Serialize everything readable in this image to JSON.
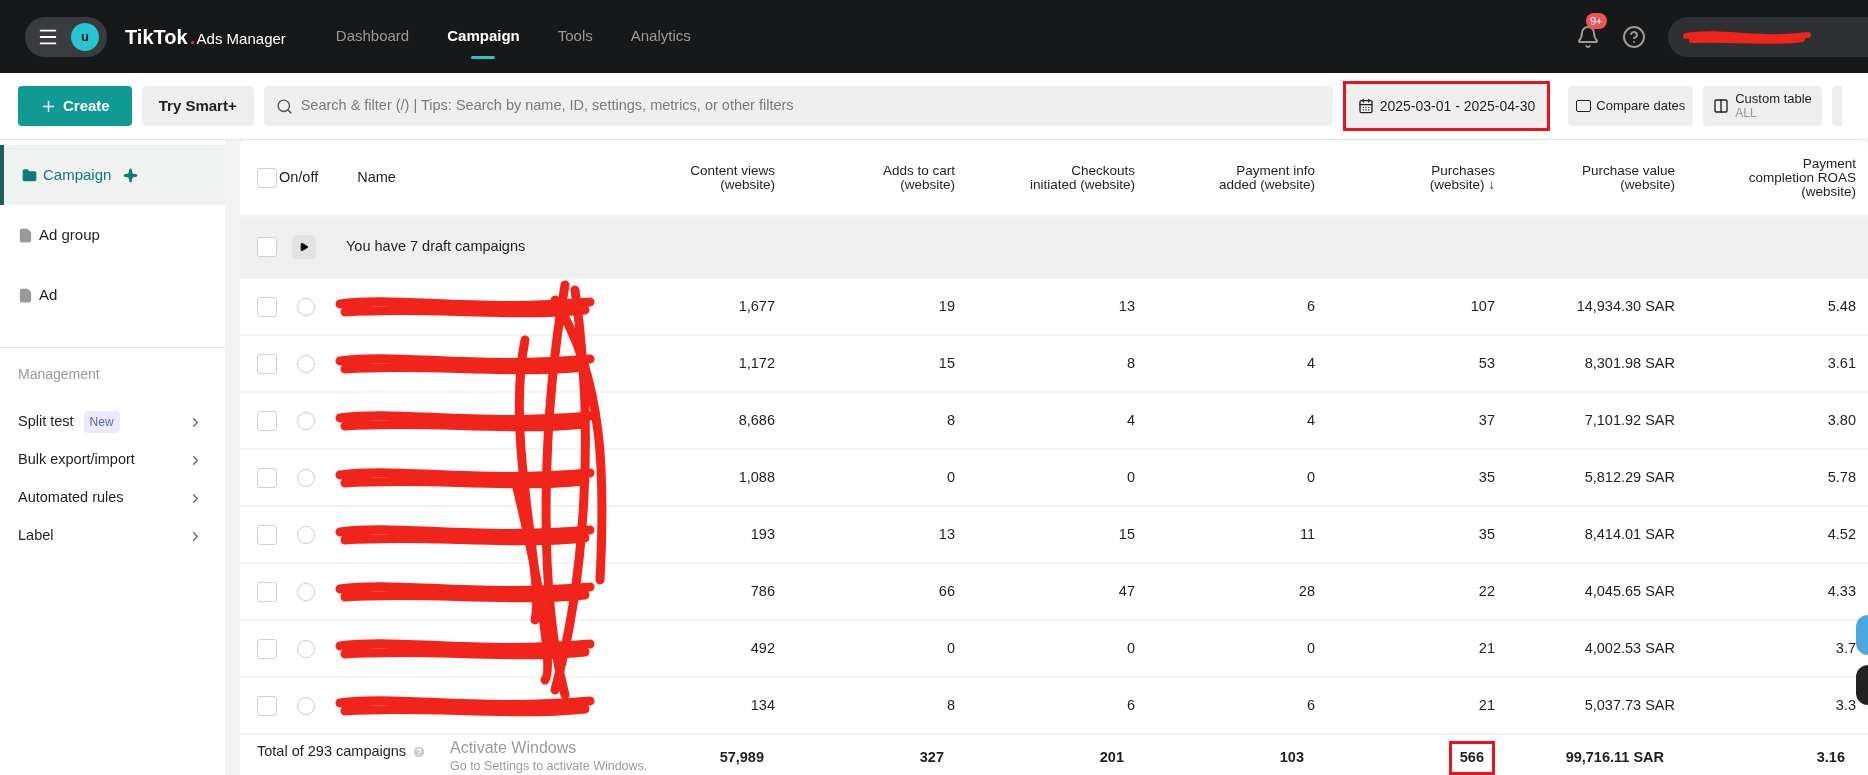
{
  "top_bar": {
    "avatar": "u",
    "logo": "TikTok",
    "logo_suffix": "Ads Manager",
    "nav": [
      {
        "label": "Dashboard",
        "selected": false
      },
      {
        "label": "Campaign",
        "selected": true
      },
      {
        "label": "Tools",
        "selected": false
      },
      {
        "label": "Analytics",
        "selected": false
      }
    ],
    "notification_badge": "9+"
  },
  "toolbar": {
    "create": "Create",
    "smart": "Try Smart+",
    "search": {
      "placeholder": "Search & filter (/) | Tips: Search by name, ID, settings, metrics, or other filters"
    },
    "date_range": {
      "label": "2025-03-01 - 2025-04-30",
      "highlighted": true
    },
    "compare": "Compare dates",
    "custom_table": {
      "label": "Custom table",
      "sub": "ALL"
    }
  },
  "sidebar": {
    "levels": [
      {
        "label": "Campaign",
        "selected": true
      },
      {
        "label": "Ad group",
        "selected": false
      },
      {
        "label": "Ad",
        "selected": false
      }
    ],
    "section": "Management",
    "items": [
      {
        "label": "Split test",
        "badge": "New"
      },
      {
        "label": "Bulk export/import"
      },
      {
        "label": "Automated rules"
      },
      {
        "label": "Label"
      }
    ]
  },
  "table": {
    "select_all": {
      "checked": false
    },
    "onoff": "On/off",
    "name": "Name",
    "columns": [
      "Content views\n(website)",
      "Adds to cart\n(website)",
      "Checkouts\ninitiated (website)",
      "Payment info\nadded (website)",
      "Purchases\n(website) ↓",
      "Purchase value\n(website)",
      "Payment\ncompletion ROAS\n(website)"
    ],
    "draft_row": {
      "text": "You have 7 draft campaigns",
      "checked": false
    },
    "rows": [
      {
        "checked": false,
        "cells": [
          "1,677",
          "19",
          "13",
          "6",
          "107",
          "14,934.30 SAR",
          "5.48"
        ]
      },
      {
        "checked": false,
        "cells": [
          "1,172",
          "15",
          "8",
          "4",
          "53",
          "8,301.98 SAR",
          "3.61"
        ]
      },
      {
        "checked": false,
        "cells": [
          "8,686",
          "8",
          "4",
          "4",
          "37",
          "7,101.92 SAR",
          "3.80"
        ]
      },
      {
        "checked": false,
        "cells": [
          "1,088",
          "0",
          "0",
          "0",
          "35",
          "5,812.29 SAR",
          "5.78"
        ]
      },
      {
        "checked": false,
        "cells": [
          "193",
          "13",
          "15",
          "11",
          "35",
          "8,414.01 SAR",
          "4.52"
        ]
      },
      {
        "checked": false,
        "cells": [
          "786",
          "66",
          "47",
          "28",
          "22",
          "4,045.65 SAR",
          "4.33"
        ]
      },
      {
        "checked": false,
        "cells": [
          "492",
          "0",
          "0",
          "0",
          "21",
          "4,002.53 SAR",
          "3.7"
        ]
      },
      {
        "checked": false,
        "cells": [
          "134",
          "8",
          "6",
          "6",
          "21",
          "5,037.73 SAR",
          "3.3"
        ]
      }
    ],
    "total": {
      "label": "Total of 293 campaigns",
      "values": [
        {
          "text": "57,989",
          "highlighted": false
        },
        {
          "text": "327",
          "highlighted": false
        },
        {
          "text": "201",
          "highlighted": false
        },
        {
          "text": "103",
          "highlighted": false
        },
        {
          "text": "566",
          "highlighted": true
        },
        {
          "text": "99,716.11 SAR",
          "highlighted": false
        },
        {
          "text": "3.16",
          "highlighted": false
        }
      ]
    }
  },
  "os_overlay": {
    "title": "Activate Windows",
    "message": "Go to Settings to activate Windows."
  }
}
